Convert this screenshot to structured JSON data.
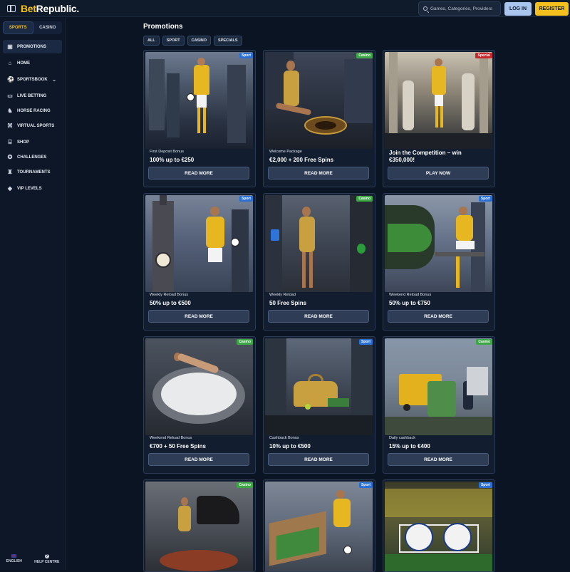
{
  "brand": {
    "part1": "Bet",
    "part2": "Republic."
  },
  "header": {
    "search_placeholder": "Games, Categories, Providers",
    "login_label": "LOG IN",
    "register_label": "REGISTER"
  },
  "sidebar": {
    "tabs": [
      {
        "label": "SPORTS",
        "active": true
      },
      {
        "label": "CASINO",
        "active": false
      }
    ],
    "items": [
      {
        "label": "PROMOTIONS",
        "icon": "gift-icon",
        "active": true
      },
      {
        "label": "HOME",
        "icon": "home-icon"
      },
      {
        "label": "SPORTSBOOK",
        "icon": "football-icon",
        "has_chevron": true
      },
      {
        "label": "LIVE BETTING",
        "icon": "live-icon"
      },
      {
        "label": "HORSE RACING",
        "icon": "horse-icon"
      },
      {
        "label": "VIRTUAL SPORTS",
        "icon": "virtual-icon"
      },
      {
        "label": "SHOP",
        "icon": "shop-icon"
      },
      {
        "label": "CHALLENGES",
        "icon": "challenge-icon"
      },
      {
        "label": "TOURNAMENTS",
        "icon": "trophy-icon"
      },
      {
        "label": "VIP LEVELS",
        "icon": "diamond-icon"
      }
    ],
    "footer": {
      "language": "ENGLISH",
      "help": "HELP CENTRE"
    }
  },
  "main": {
    "title": "Promotions",
    "filters": [
      "ALL",
      "SPORT",
      "CASINO",
      "SPECIALS"
    ],
    "cards": [
      {
        "badge": "Sport",
        "badge_type": "sport",
        "subtitle": "First Deposit Bonus",
        "title": "100% up to €250",
        "button": "READ MORE"
      },
      {
        "badge": "Casino",
        "badge_type": "casino",
        "subtitle": "Welcome Package",
        "title": "€2,000 + 200 Free Spins",
        "button": "READ MORE"
      },
      {
        "badge": "Special",
        "badge_type": "special",
        "subtitle": "",
        "title": "Join the Competition – win €350,000!",
        "button": "PLAY NOW"
      },
      {
        "badge": "Sport",
        "badge_type": "sport",
        "subtitle": "Weekly Reload Bonus",
        "title": "50% up to €500",
        "button": "READ MORE"
      },
      {
        "badge": "Casino",
        "badge_type": "casino",
        "subtitle": "Weekly Reload",
        "title": "50 Free Spins",
        "button": "READ MORE"
      },
      {
        "badge": "Sport",
        "badge_type": "sport",
        "subtitle": "Weekend Reload Bonus",
        "title": "50% up to €750",
        "button": "READ MORE"
      },
      {
        "badge": "Casino",
        "badge_type": "casino",
        "subtitle": "Weekend Reload Bonus",
        "title": "€700 + 50 Free Spins",
        "button": "READ MORE"
      },
      {
        "badge": "Sport",
        "badge_type": "sport",
        "subtitle": "Cashback Bonus",
        "title": "10% up to €500",
        "button": "READ MORE"
      },
      {
        "badge": "Casino",
        "badge_type": "casino",
        "subtitle": "Daily cashback",
        "title": "15% up to €400",
        "button": "READ MORE"
      },
      {
        "badge": "Casino",
        "badge_type": "casino"
      },
      {
        "badge": "Sport",
        "badge_type": "sport"
      },
      {
        "badge": "Sport",
        "badge_type": "sport"
      }
    ]
  },
  "colors": {
    "brand_yellow": "#f4c01d",
    "login_blue": "#a9c5ee",
    "sport_badge": "#2a6fd6",
    "casino_badge": "#3ca845",
    "special_badge": "#c8262b"
  }
}
